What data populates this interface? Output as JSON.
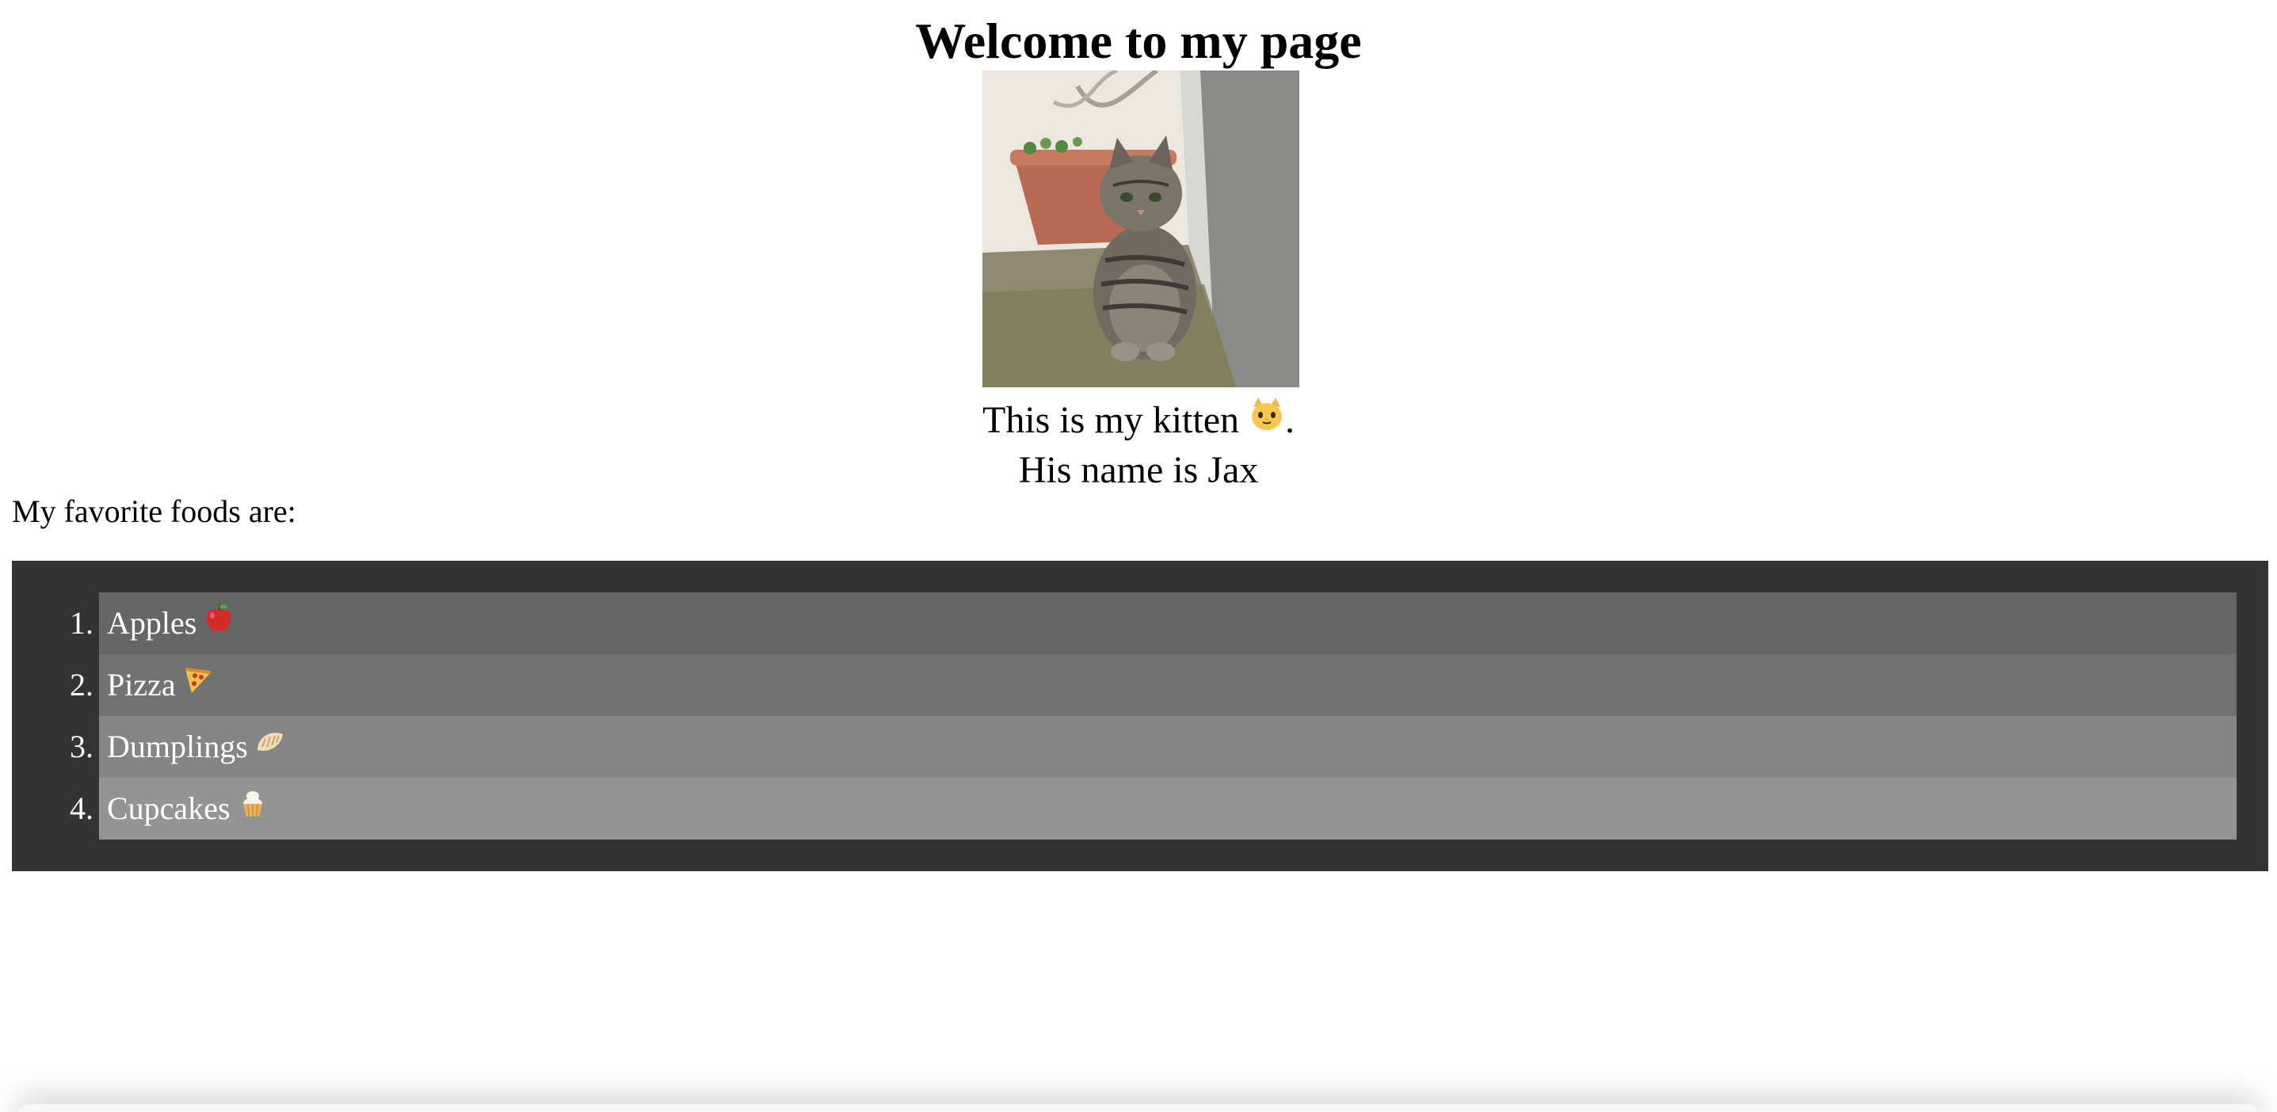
{
  "page": {
    "title": "Welcome to my page",
    "caption_line1": "This is my kitten",
    "caption_line1_end": ".",
    "caption_line2": "His name is Jax",
    "foods_intro": "My favorite foods are:"
  },
  "foods": [
    {
      "num": "1.",
      "label": "Apples",
      "icon": "apple-icon",
      "color": "#666666"
    },
    {
      "num": "2.",
      "label": "Pizza",
      "icon": "pizza-icon",
      "color": "#727272"
    },
    {
      "num": "3.",
      "label": "Dumplings",
      "icon": "dumpling-icon",
      "color": "#858585"
    },
    {
      "num": "4.",
      "label": "Cupcakes",
      "icon": "cupcake-icon",
      "color": "#949494"
    }
  ],
  "colors": {
    "panel": "#333333",
    "text_on_panel": "#ffffff"
  }
}
